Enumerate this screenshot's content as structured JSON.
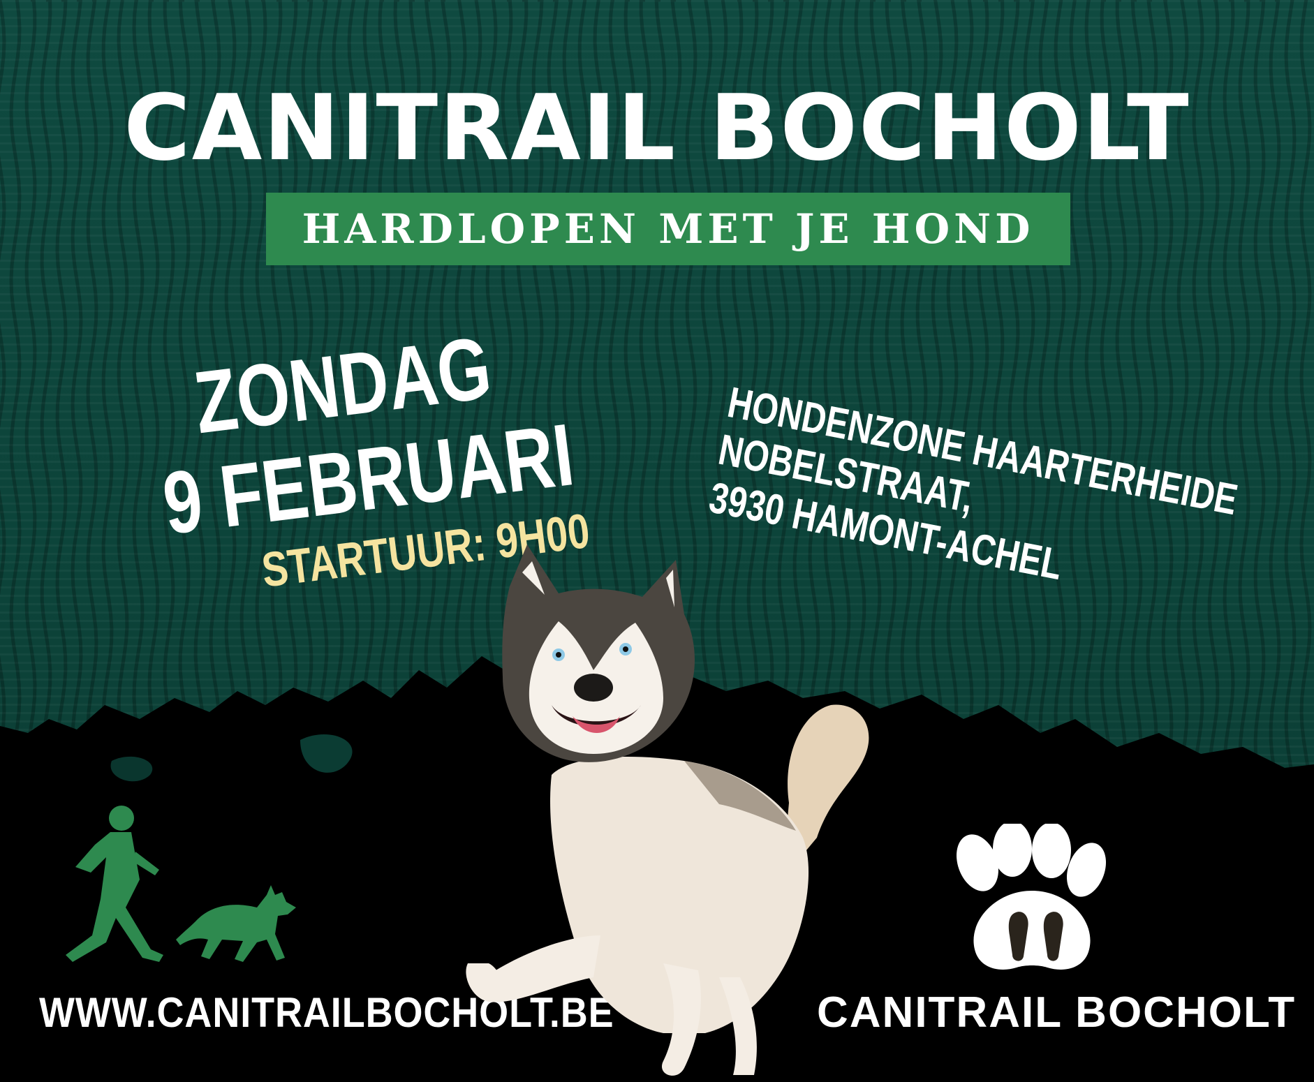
{
  "poster": {
    "title": "CANITRAIL BOCHOLT",
    "subtitle": "HARDLOPEN MET JE HOND",
    "date": {
      "line1": "ZONDAG",
      "line2": "9 FEBRUARI"
    },
    "start_time": "STARTUUR: 9H00",
    "address": {
      "line1": "HONDENZONE HAARTERHEIDE",
      "line2": "NOBELSTRAAT,",
      "line3": "3930 HAMONT-ACHEL"
    },
    "website": "WWW.CANITRAILBOCHOLT.BE",
    "logo_text": "CANITRAIL BOCHOLT"
  },
  "icons": {
    "runner": "runner-with-dog-icon",
    "paw": "paw-logo-icon",
    "dog": "husky-photo"
  },
  "colors": {
    "background_green": "#0c4339",
    "accent_green": "#2e8a4f",
    "highlight_yellow": "#f5e4a0",
    "text_white": "#ffffff",
    "ground_black": "#000000"
  }
}
